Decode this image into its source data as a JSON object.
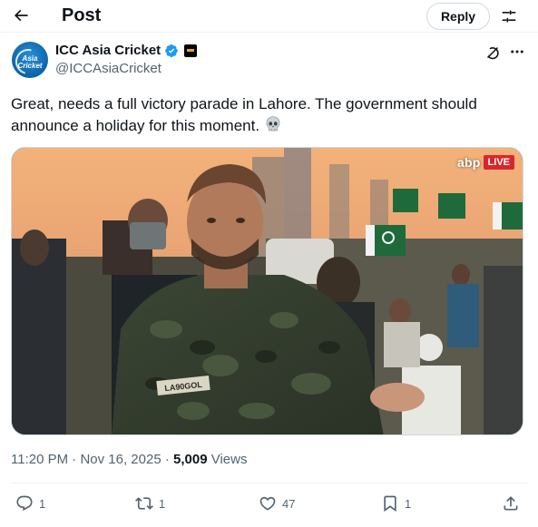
{
  "header": {
    "title": "Post",
    "reply_label": "Reply"
  },
  "author": {
    "name": "ICC Asia Cricket",
    "handle": "@ICCAsiaCricket",
    "avatar_text": "Asia Cricket"
  },
  "tweet": {
    "text": "Great,  needs a full victory parade in Lahore. The government should announce a holiday for this moment.",
    "emoji": "skull"
  },
  "media": {
    "channel": "abp",
    "live_label": "LIVE",
    "shirt_label": "LA90GOL"
  },
  "meta": {
    "time": "11:20 PM",
    "date": "Nov 16, 2025",
    "views_count": "5,009",
    "views_label": "Views"
  },
  "actions": {
    "replies": "1",
    "reposts": "1",
    "likes": "47",
    "bookmarks": "1"
  },
  "colors": {
    "text_primary": "#0f1419",
    "text_secondary": "#536471",
    "verified_blue": "#1d9bf0",
    "live_red": "#d9262c",
    "border": "#cfd9de"
  }
}
